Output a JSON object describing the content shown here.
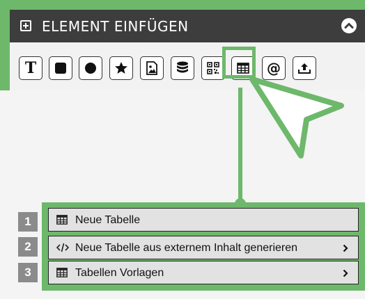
{
  "panel": {
    "title": "ELEMENT EINFÜGEN",
    "tools": [
      {
        "name": "text-tool",
        "icon": "text-icon",
        "glyph": "T"
      },
      {
        "name": "rectangle-tool",
        "icon": "square-icon"
      },
      {
        "name": "circle-tool",
        "icon": "circle-icon"
      },
      {
        "name": "star-tool",
        "icon": "star-icon"
      },
      {
        "name": "image-tool",
        "icon": "image-file-icon"
      },
      {
        "name": "database-tool",
        "icon": "database-icon"
      },
      {
        "name": "qr-code-tool",
        "icon": "qr-code-icon"
      },
      {
        "name": "table-tool",
        "icon": "table-icon"
      },
      {
        "name": "email-tool",
        "icon": "at-icon",
        "glyph": "@"
      },
      {
        "name": "upload-tool",
        "icon": "upload-icon"
      }
    ]
  },
  "menu": {
    "items": [
      {
        "step": "1",
        "label": "Neue Tabelle",
        "icon": "table-icon",
        "has_submenu": false
      },
      {
        "step": "2",
        "label": "Neue Tabelle aus externem Inhalt generieren",
        "icon": "code-icon",
        "has_submenu": true
      },
      {
        "step": "3",
        "label": "Tabellen Vorlagen",
        "icon": "table-icon",
        "has_submenu": true
      }
    ]
  },
  "colors": {
    "highlight": "#6db86b",
    "header_bg": "#3d3d3d",
    "menu_bg": "#e2e2e2",
    "step_bg": "#8b8b8b"
  }
}
